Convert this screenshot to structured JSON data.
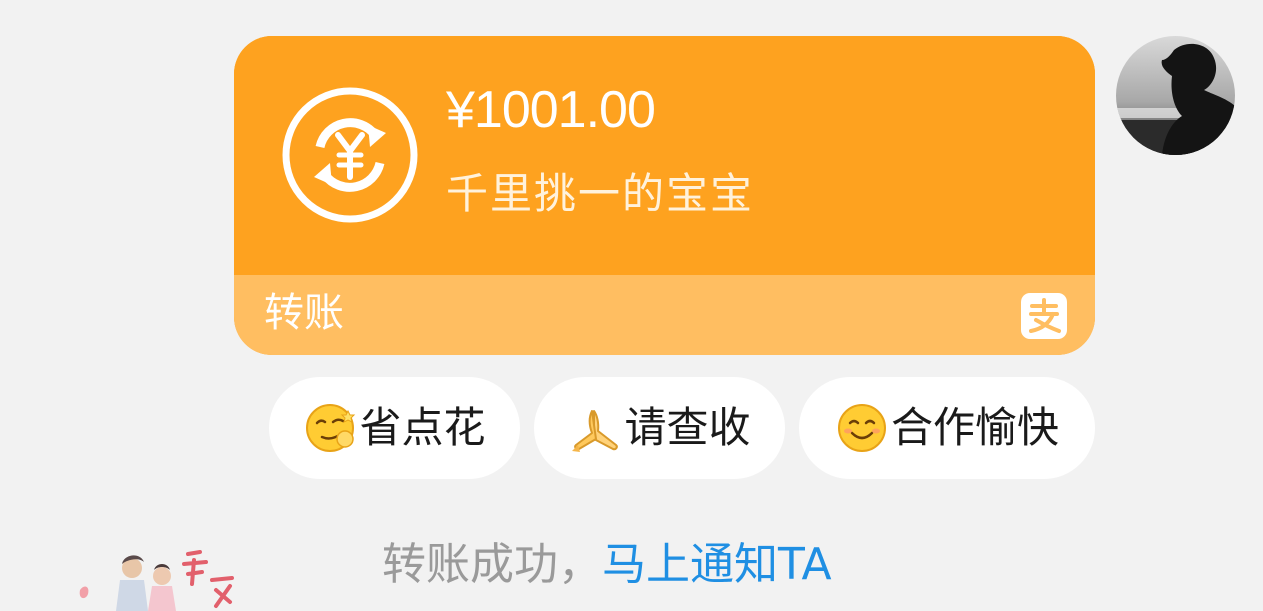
{
  "transfer": {
    "amount": "¥1001.00",
    "memo": "千里挑一的宝宝",
    "footer_label": "转账",
    "icon": "yen-exchange-icon",
    "brand_icon": "alipay-icon",
    "colors": {
      "card": "#fea21f",
      "footer": "#ffbe61"
    }
  },
  "quick_replies": [
    {
      "emoji": "smirk-emoji",
      "text": "省点花"
    },
    {
      "emoji": "pray-hands-emoji",
      "text": "请查收"
    },
    {
      "emoji": "smile-emoji",
      "text": "合作愉快"
    }
  ],
  "status": {
    "text": "转账成功，",
    "link": "马上通知TA",
    "link_color": "#1f8fe3"
  },
  "avatar": {
    "icon": "user-avatar"
  },
  "sticker": {
    "icon": "sticker-decoration"
  }
}
